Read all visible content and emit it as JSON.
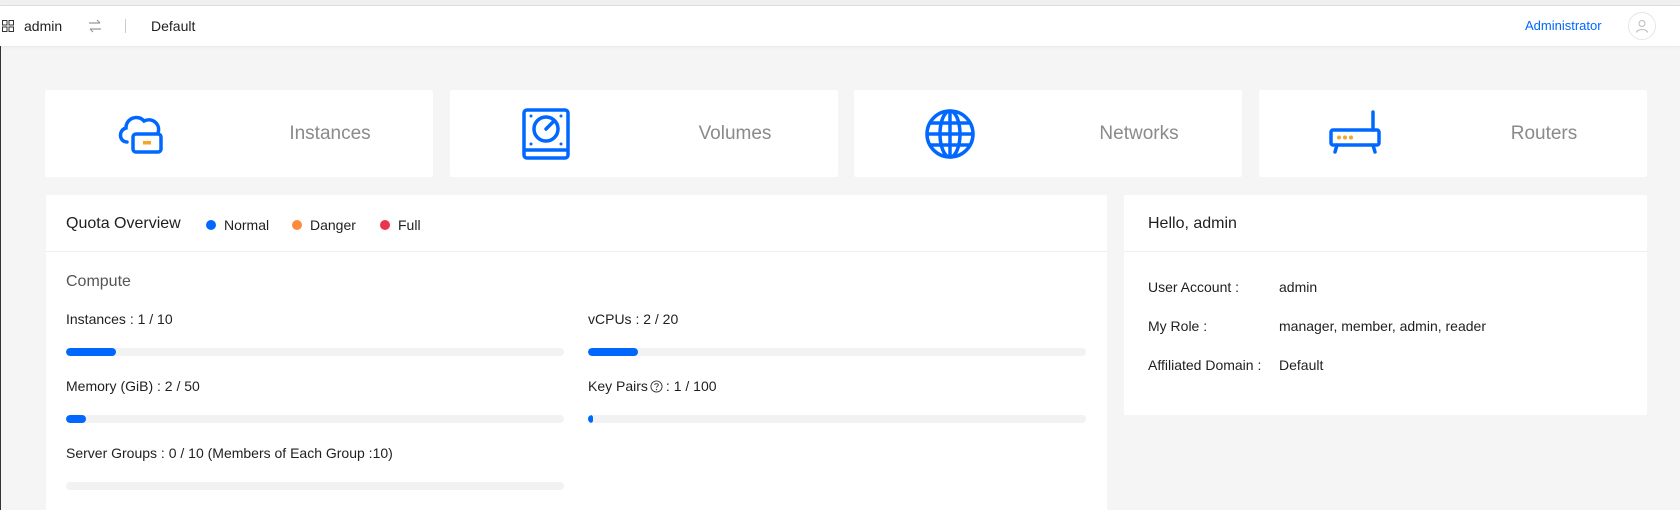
{
  "header": {
    "user": "admin",
    "project": "Default",
    "role": "Administrator"
  },
  "resources": [
    {
      "label": "Instances",
      "icon": "cloud-server-icon"
    },
    {
      "label": "Volumes",
      "icon": "volume-disk-icon"
    },
    {
      "label": "Networks",
      "icon": "globe-network-icon"
    },
    {
      "label": "Routers",
      "icon": "router-icon"
    }
  ],
  "quota": {
    "title": "Quota Overview",
    "legend": [
      {
        "label": "Normal",
        "color": "#0068ff"
      },
      {
        "label": "Danger",
        "color": "#fe8a3e"
      },
      {
        "label": "Full",
        "color": "#eb354d"
      }
    ],
    "section": "Compute",
    "items": [
      {
        "name": "Instances",
        "text": "Instances : 1 / 10",
        "fraction": 0.1
      },
      {
        "name": "vCPUs",
        "text": "vCPUs : 2 / 20",
        "fraction": 0.1
      },
      {
        "name": "Memory",
        "text": "Memory (GiB) : 2 / 50",
        "fraction": 0.04
      },
      {
        "name": "Key Pairs",
        "label_pre": "Key Pairs",
        "label_post": ": 1 / 100",
        "fraction": 0.01
      },
      {
        "name": "Server Groups",
        "text": "Server Groups : 0 / 10 (Members of Each Group :10)",
        "fraction": 0
      }
    ]
  },
  "hello": {
    "title": "Hello, admin",
    "rows": [
      {
        "key": "User Account :",
        "value": "admin"
      },
      {
        "key": "My Role :",
        "value": "manager, member, admin, reader"
      },
      {
        "key": "Affiliated Domain :",
        "value": "Default"
      }
    ]
  }
}
